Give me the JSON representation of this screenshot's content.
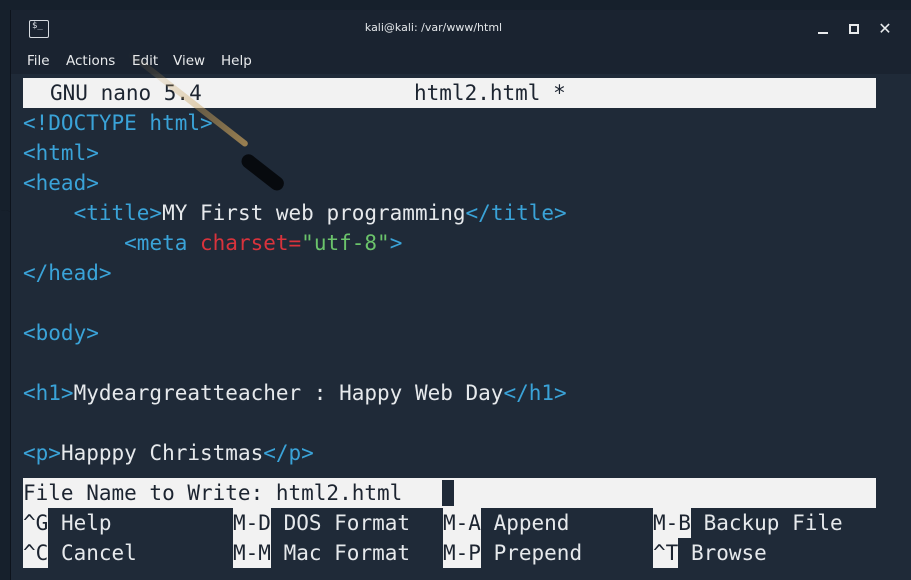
{
  "window": {
    "title": "kali@kali: /var/www/html",
    "app_icon_glyph": "$_",
    "controls": {
      "minimize": "minimize",
      "maximize": "maximize",
      "close": "✕"
    }
  },
  "menubar": {
    "items": [
      "File",
      "Actions",
      "Edit",
      "View",
      "Help"
    ]
  },
  "nano": {
    "version": "GNU nano 5.4",
    "filename": "html2.html *",
    "lines": [
      [
        {
          "t": "<!DOCTYPE html>",
          "c": "tag"
        }
      ],
      [
        {
          "t": "<html>",
          "c": "tag"
        }
      ],
      [
        {
          "t": "<head>",
          "c": "tag"
        }
      ],
      [
        {
          "t": "    ",
          "c": "txt"
        },
        {
          "t": "<title>",
          "c": "tag"
        },
        {
          "t": "MY First web programming",
          "c": "txt"
        },
        {
          "t": "</title>",
          "c": "tag"
        }
      ],
      [
        {
          "t": "        ",
          "c": "txt"
        },
        {
          "t": "<meta ",
          "c": "tag"
        },
        {
          "t": "charset=",
          "c": "attr"
        },
        {
          "t": "\"utf-8\"",
          "c": "str"
        },
        {
          "t": ">",
          "c": "tag"
        }
      ],
      [
        {
          "t": "</head>",
          "c": "tag"
        }
      ],
      [],
      [
        {
          "t": "<body>",
          "c": "tag"
        }
      ],
      [],
      [
        {
          "t": "<h1>",
          "c": "tag"
        },
        {
          "t": "Mydeargreatteacher : Happy Web Day",
          "c": "txt"
        },
        {
          "t": "</h1>",
          "c": "tag"
        }
      ],
      [],
      [
        {
          "t": "<p>",
          "c": "tag"
        },
        {
          "t": "Happpy Christmas",
          "c": "txt"
        },
        {
          "t": "</p>",
          "c": "tag"
        }
      ]
    ],
    "prompt": "File Name to Write: html2.html",
    "shortcuts": [
      [
        {
          "key": "^G",
          "desc": " Help"
        },
        {
          "key": "M-D",
          "desc": " DOS Format"
        },
        {
          "key": "M-A",
          "desc": " Append"
        },
        {
          "key": "M-B",
          "desc": " Backup File"
        }
      ],
      [
        {
          "key": "^C",
          "desc": " Cancel"
        },
        {
          "key": "M-M",
          "desc": " Mac Format"
        },
        {
          "key": "M-P",
          "desc": " Prepend"
        },
        {
          "key": "^T",
          "desc": " Browse"
        }
      ]
    ]
  },
  "colors": {
    "tag": "#3aa3d8",
    "attr": "#d9333c",
    "string": "#6bc46b",
    "text": "#e6e9ec",
    "bar": "#f2f2f2"
  }
}
